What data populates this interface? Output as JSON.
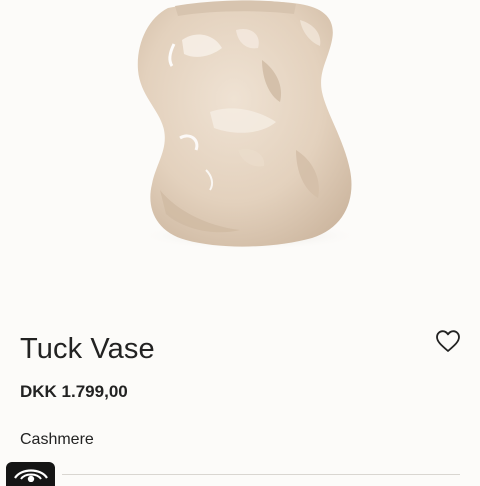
{
  "product": {
    "image_alt": "Tuck Vase",
    "title": "Tuck Vase",
    "price": "DKK 1.799,00",
    "color_label": "Cashmere"
  },
  "icons": {
    "wishlist": "heart-outline-icon",
    "swatch": "eye-icon"
  },
  "colors": {
    "background": "#fcfbf9",
    "text": "#222222",
    "vase": "#e6d5c3",
    "swatch": "#151515"
  }
}
